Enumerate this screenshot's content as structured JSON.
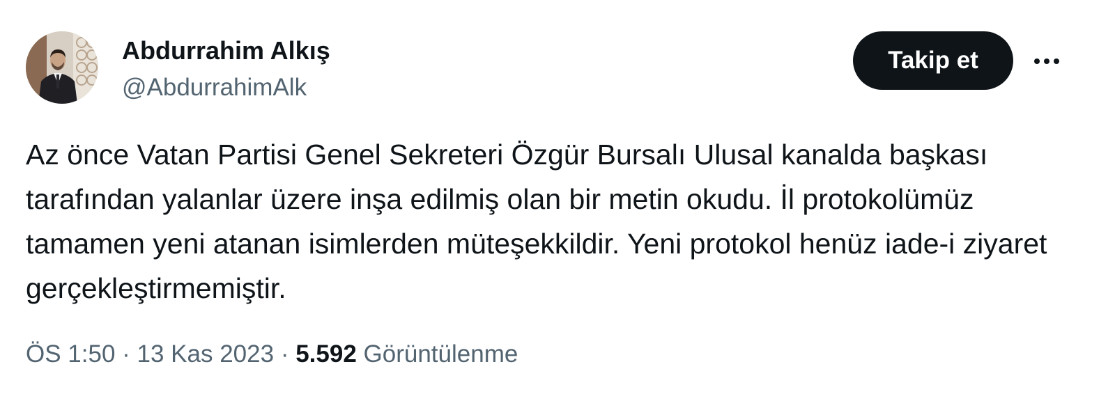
{
  "author": {
    "display_name": "Abdurrahim Alkış",
    "handle": "@AbdurrahimAlk",
    "avatar_icon": "profile-photo"
  },
  "actions": {
    "follow_label": "Takip et",
    "more_icon": "more-dots-icon"
  },
  "tweet": {
    "text": "Az önce Vatan Partisi Genel Sekreteri Özgür Bursalı Ulusal kanalda başkası tarafından yalanlar üzere inşa edilmiş olan bir metin okudu. İl protokolümüz tamamen yeni atanan isimlerden müteşekkildir. Yeni protokol henüz iade-i ziyaret gerçekleştirmemiştir."
  },
  "meta": {
    "time": "ÖS 1:50",
    "separator": " · ",
    "date": "13 Kas 2023",
    "views_count": "5.592",
    "views_label": "Görüntülenme"
  },
  "colors": {
    "text_primary": "#0f1419",
    "text_secondary": "#536471",
    "button_bg": "#0f1419",
    "button_text": "#ffffff"
  }
}
